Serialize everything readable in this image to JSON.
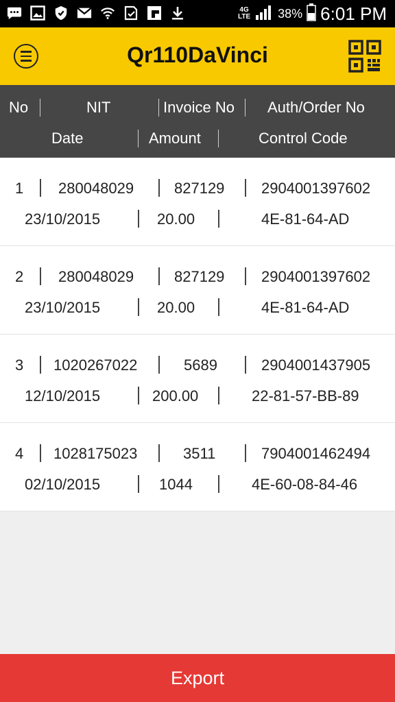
{
  "status_bar": {
    "icons": [
      "chat-icon",
      "image-icon",
      "shield-icon",
      "mail-icon",
      "wifi-icon",
      "download-check-icon",
      "flipboard-icon",
      "download-icon",
      "lte-icon",
      "signal-icon"
    ],
    "network_label": "4G",
    "battery": "38%",
    "time": "6:01 PM"
  },
  "appbar": {
    "title": "Qr110DaVinci",
    "accent_color": "#f9c900"
  },
  "columns": {
    "no": "No",
    "nit": "NIT",
    "invoice_no": "Invoice No",
    "auth_order_no": "Auth/Order No",
    "date": "Date",
    "amount": "Amount",
    "control_code": "Control Code"
  },
  "invoices": [
    {
      "no": "1",
      "nit": "280048029",
      "invoice_no": "827129",
      "auth_order_no": "2904001397602",
      "date": "23/10/2015",
      "amount": "20.00",
      "control_code": "4E-81-64-AD"
    },
    {
      "no": "2",
      "nit": "280048029",
      "invoice_no": "827129",
      "auth_order_no": "2904001397602",
      "date": "23/10/2015",
      "amount": "20.00",
      "control_code": "4E-81-64-AD"
    },
    {
      "no": "3",
      "nit": "1020267022",
      "invoice_no": "5689",
      "auth_order_no": "2904001437905",
      "date": "12/10/2015",
      "amount": "200.00",
      "control_code": "22-81-57-BB-89"
    },
    {
      "no": "4",
      "nit": "1028175023",
      "invoice_no": "3511",
      "auth_order_no": "7904001462494",
      "date": "02/10/2015",
      "amount": "1044",
      "control_code": "4E-60-08-84-46"
    }
  ],
  "export_label": "Export",
  "export_color": "#e53935"
}
